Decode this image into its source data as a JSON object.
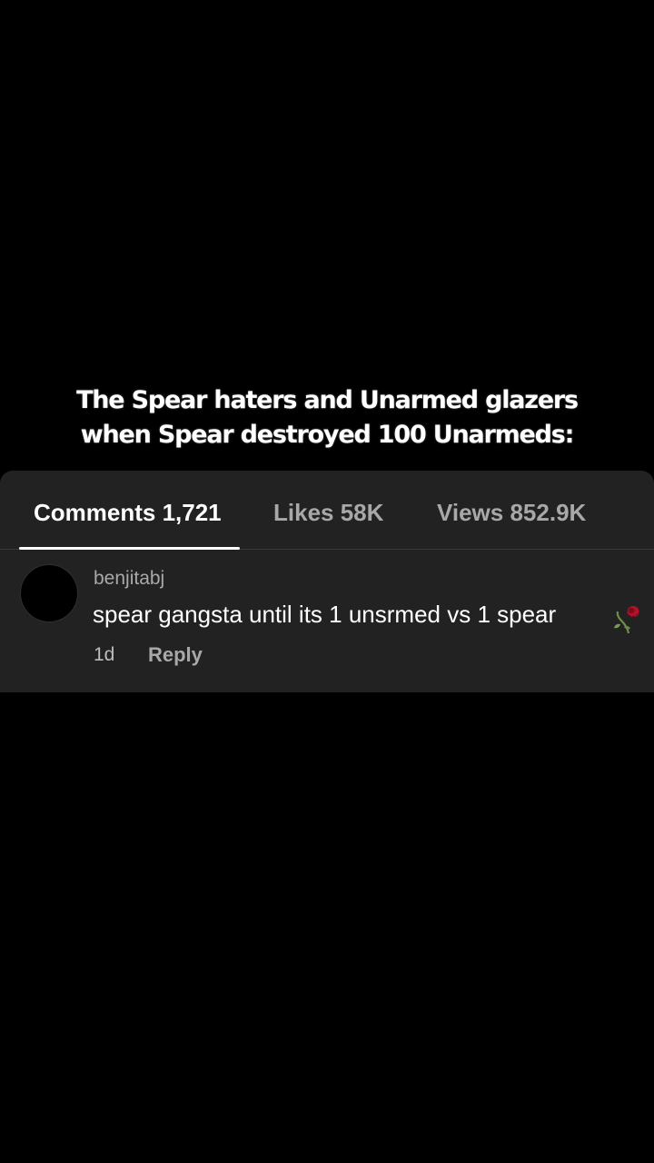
{
  "caption": {
    "line1": "The Spear haters and Unarmed glazers",
    "line2": "when Spear destroyed 100 Unarmeds:"
  },
  "tabs": {
    "comments": "Comments 1,721",
    "likes": "Likes 58K",
    "views": "Views 852.9K",
    "active": "comments"
  },
  "comment": {
    "username": "benjitabj",
    "text": "spear gangsta until its 1 unsrmed vs 1 spear",
    "emoji_icon": "wilted-rose-icon",
    "time": "1d",
    "reply_label": "Reply"
  },
  "colors": {
    "background": "#000000",
    "panel": "#222222",
    "active_tab": "#ffffff",
    "inactive_tab": "#a8a8a8"
  }
}
